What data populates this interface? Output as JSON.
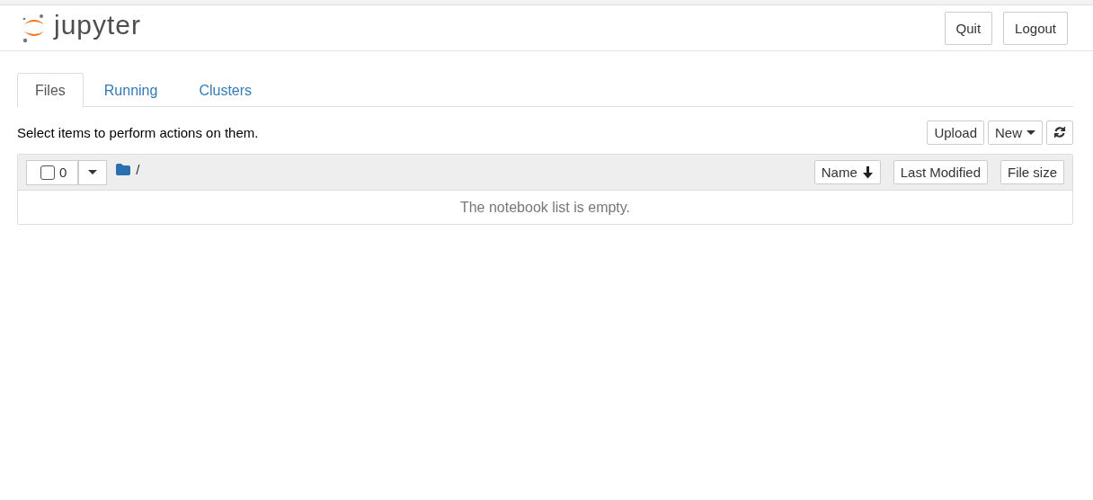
{
  "logo": {
    "text": "jupyter"
  },
  "header_buttons": [
    "Quit",
    "Logout"
  ],
  "tabs": [
    {
      "label": "Files",
      "selected": true
    },
    {
      "label": "Running",
      "selected": false
    },
    {
      "label": "Clusters",
      "selected": false
    }
  ],
  "instructions": "Select items to perform actions on them.",
  "toolbar": [
    {
      "kind": "plain",
      "label": "Upload"
    },
    {
      "kind": "dropdown",
      "label": "New"
    },
    {
      "kind": "refresh"
    }
  ],
  "list": {
    "select_all": {
      "checked": false,
      "count": "0"
    },
    "path": "/",
    "sort_buttons": [
      {
        "label": "Name",
        "sorted": true
      },
      {
        "label": "Last Modified",
        "sorted": false
      },
      {
        "label": "File size",
        "sorted": false
      }
    ],
    "empty_message": "The notebook list is empty."
  }
}
